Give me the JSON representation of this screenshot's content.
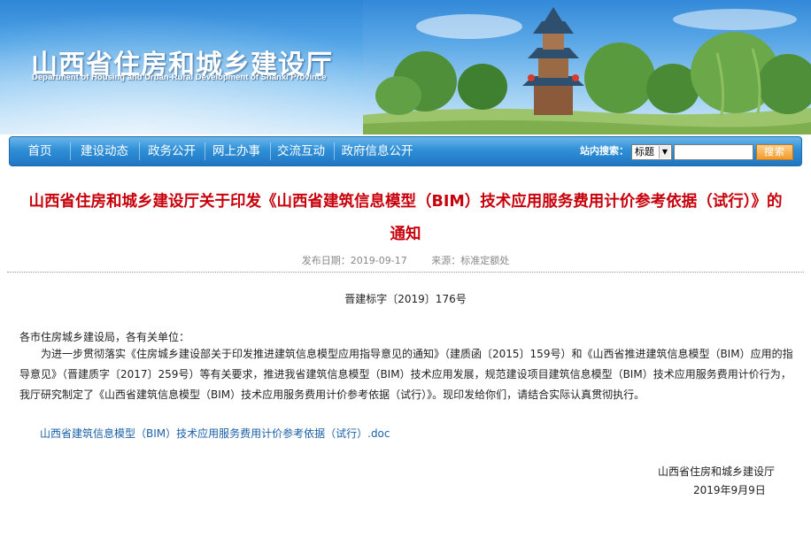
{
  "header": {
    "title": "山西省住房和城乡建设厅",
    "subtitle": "Department of Housing and Urban-Rural Development of Shanxi Province"
  },
  "nav": {
    "items": [
      "首页",
      "建设动态",
      "政务公开",
      "网上办事",
      "交流互动",
      "政府信息公开"
    ],
    "search_label": "站内搜索：",
    "search_scope": "标题",
    "search_button": "搜索"
  },
  "article": {
    "title_line1": "山西省住房和城乡建设厅关于印发《山西省建筑信息模型（BIM）技术应用服务费用计价参考依据（试行）》的",
    "title_line2": "通知",
    "publish_date": "发布日期：2019-09-17",
    "source": "来源：标准定额处",
    "doc_number": "晋建标字〔2019〕176号",
    "salutation": "各市住房城乡建设局，各有关单位：",
    "body": "为进一步贯彻落实《住房城乡建设部关于印发推进建筑信息模型应用指导意见的通知》（建质函〔2015〕159号）和《山西省推进建筑信息模型（BIM）应用的指导意见》（晋建质字〔2017〕259号）等有关要求，推进我省建筑信息模型（BIM）技术应用发展，规范建设项目建筑信息模型（BIM）技术应用服务费用计价行为，我厅研究制定了《山西省建筑信息模型（BIM）技术应用服务费用计价参考依据（试行）》。现印发给你们，请结合实际认真贯彻执行。",
    "attachment": "山西省建筑信息模型（BIM）技术应用服务费用计价参考依据（试行）.doc",
    "signature_org": "山西省住房和城乡建设厅",
    "signature_date": "2019年9月9日"
  },
  "colors": {
    "title_red": "#c7000b",
    "nav_blue": "#2f8fd6",
    "link_blue": "#1a5fa8",
    "meta_gray": "#888888"
  },
  "icons": [
    "dropdown-arrow-icon"
  ]
}
